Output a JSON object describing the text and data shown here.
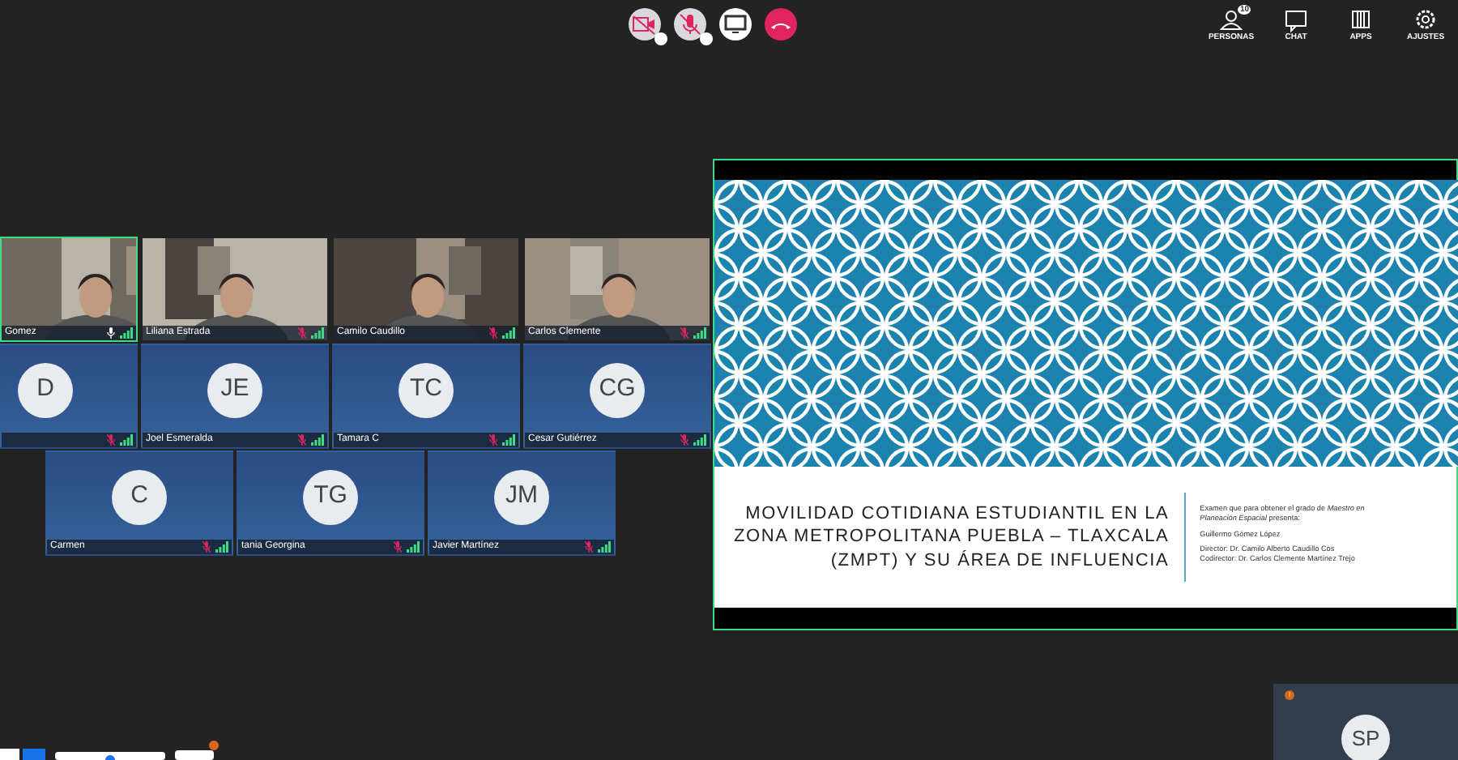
{
  "call_controls": [
    {
      "kind": "camera",
      "muted": true
    },
    {
      "kind": "mic",
      "muted": true
    },
    {
      "kind": "share"
    },
    {
      "kind": "hangup"
    }
  ],
  "top_menu": [
    {
      "kind": "people",
      "label": "PERSONAS",
      "badge": "10"
    },
    {
      "kind": "chat",
      "label": "CHAT"
    },
    {
      "kind": "apps",
      "label": "APPS"
    },
    {
      "kind": "settings",
      "label": "AJUSTES"
    }
  ],
  "tile_rows": [
    [
      {
        "kind": "video",
        "name": "Gomez",
        "muted": false,
        "speaking": true
      },
      {
        "kind": "video",
        "name": "Liliana Estrada",
        "muted": true,
        "speaking": false
      },
      {
        "kind": "video",
        "name": "Camilo Caudillo",
        "muted": true,
        "speaking": false
      },
      {
        "kind": "video",
        "name": "Carlos Clemente",
        "muted": true,
        "speaking": false
      }
    ],
    [
      {
        "kind": "avatar",
        "initials": "D",
        "muted": true,
        "speaking": false
      },
      {
        "kind": "avatar",
        "initials": "JE",
        "name": "Joel Esmeralda",
        "muted": true,
        "speaking": false
      },
      {
        "kind": "avatar",
        "initials": "TC",
        "name": "Tamara C",
        "muted": true,
        "speaking": false
      },
      {
        "kind": "avatar",
        "initials": "CG",
        "name": "Cesar Gutiérrez",
        "muted": true,
        "speaking": false
      }
    ],
    [
      {
        "kind": "avatar",
        "initials": "C",
        "name": "Carmen",
        "muted": true,
        "speaking": false
      },
      {
        "kind": "avatar",
        "initials": "TG",
        "name": "tania Georgina",
        "muted": true,
        "speaking": false
      },
      {
        "kind": "avatar",
        "initials": "JM",
        "name": "Javier Martínez",
        "muted": true,
        "speaking": false
      }
    ]
  ],
  "slide": {
    "title": [
      "MOVILIDAD COTIDIANA ESTUDIANTIL EN LA",
      "ZONA METROPOLITANA PUEBLA – TLAXCALA",
      "(ZMPT) Y SU ÁREA DE INFLUENCIA"
    ],
    "details": [
      "Examen que para obtener el grado de *Maestro en Planeación Espacial* presenta:",
      "Guillermo Gómez López",
      "Director: Dr. Camilo Alberto Caudillo Cos\nCodirector: Dr. Carlos Clemente Martínez Trejo"
    ]
  },
  "self_view": {
    "initials": "SP",
    "alert": "!"
  }
}
